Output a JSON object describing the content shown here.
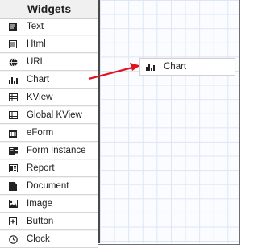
{
  "panel": {
    "title": "Widgets",
    "items": [
      {
        "label": "Text",
        "icon": "text-icon"
      },
      {
        "label": "Html",
        "icon": "html-icon"
      },
      {
        "label": "URL",
        "icon": "globe-icon"
      },
      {
        "label": "Chart",
        "icon": "bar-chart-icon"
      },
      {
        "label": "KView",
        "icon": "grid-icon"
      },
      {
        "label": "Global KView",
        "icon": "grid-icon"
      },
      {
        "label": "eForm",
        "icon": "calendar-icon"
      },
      {
        "label": "Form Instance",
        "icon": "form-icon"
      },
      {
        "label": "Report",
        "icon": "report-icon"
      },
      {
        "label": "Document",
        "icon": "document-icon"
      },
      {
        "label": "Image",
        "icon": "image-icon"
      },
      {
        "label": "Button",
        "icon": "button-icon"
      },
      {
        "label": "Clock",
        "icon": "clock-icon"
      }
    ]
  },
  "canvas": {
    "dragged_widget": {
      "label": "Chart",
      "icon": "bar-chart-icon"
    }
  },
  "colors": {
    "arrow": "#e0141e",
    "grid": "#dde6f4"
  }
}
